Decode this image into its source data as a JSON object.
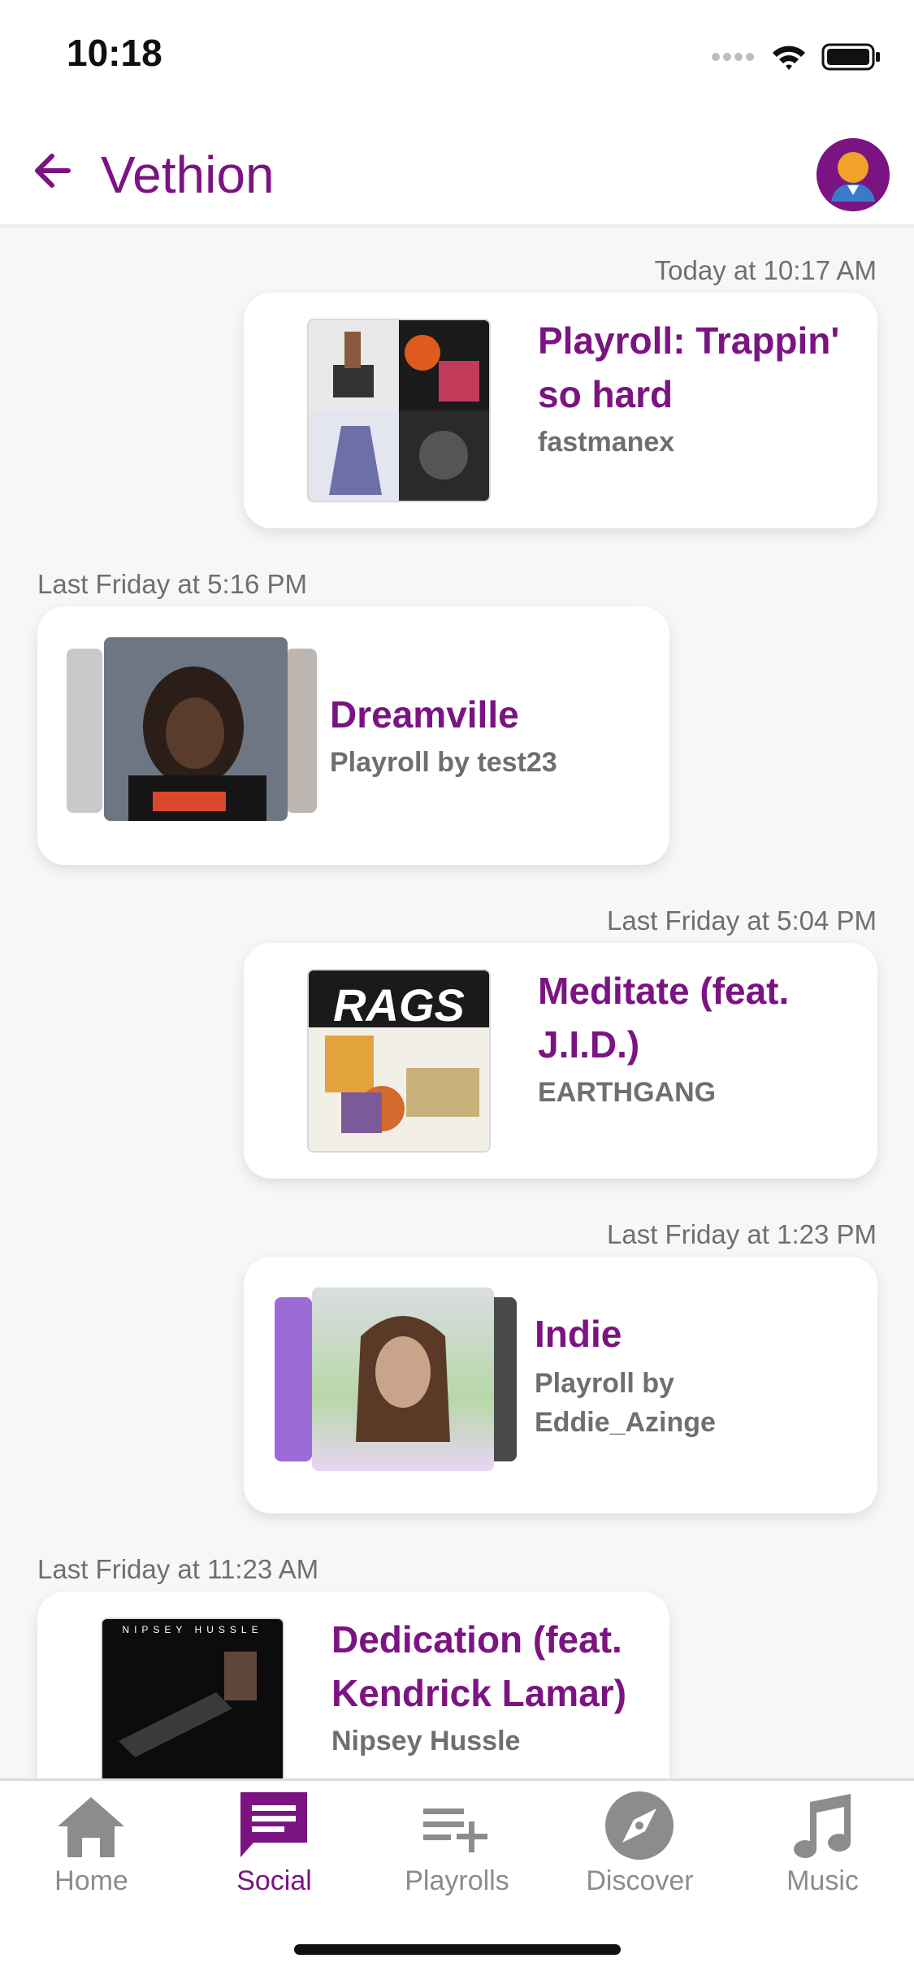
{
  "status": {
    "time": "10:18"
  },
  "header": {
    "title": "Vethion"
  },
  "feed": [
    {
      "timestamp": "Today at 10:17 AM",
      "title_line1": "Playroll: Trappin'",
      "title_line2": "so hard",
      "subtitle": "fastmanex"
    },
    {
      "timestamp": "Last Friday at 5:16 PM",
      "title_line1": "Dreamville",
      "subtitle_line1": "Playroll by test23"
    },
    {
      "timestamp": "Last Friday at 5:04 PM",
      "title_line1": "Meditate (feat.",
      "title_line2": "J.I.D.)",
      "subtitle": "EARTHGANG",
      "art_text": "RAGS"
    },
    {
      "timestamp": "Last Friday at 1:23 PM",
      "title_line1": "Indie",
      "subtitle_line1": "Playroll by",
      "subtitle_line2": "Eddie_Azinge"
    },
    {
      "timestamp": "Last Friday at 11:23 AM",
      "title_line1": "Dedication (feat.",
      "title_line2": "Kendrick Lamar)",
      "subtitle": "Nipsey Hussle",
      "art_text": "NIPSEY HUSSLE"
    }
  ],
  "tabs": [
    {
      "label": "Home",
      "icon": "home-icon"
    },
    {
      "label": "Social",
      "icon": "chat-icon",
      "active": true
    },
    {
      "label": "Playrolls",
      "icon": "playlist-add-icon"
    },
    {
      "label": "Discover",
      "icon": "compass-icon"
    },
    {
      "label": "Music",
      "icon": "music-note-icon"
    }
  ],
  "colors": {
    "accent": "#7b1482",
    "muted": "#6f6f6f",
    "inactive_tab": "#8c8c8c"
  }
}
